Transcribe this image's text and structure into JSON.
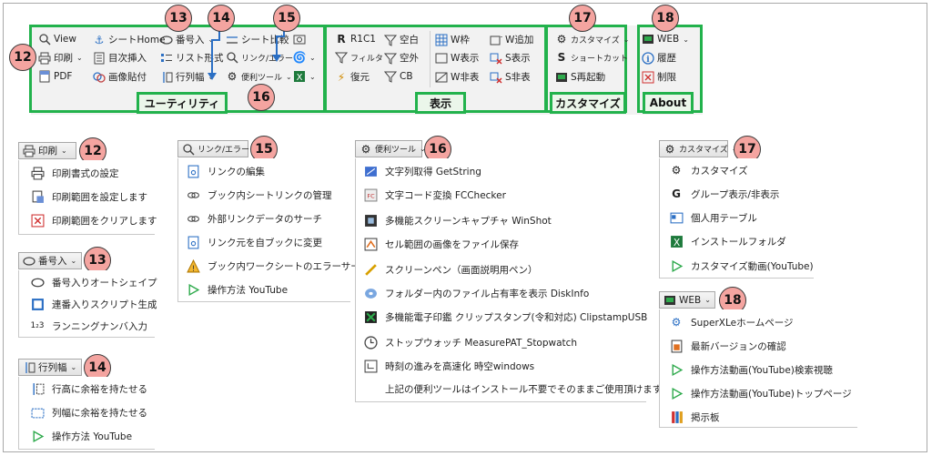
{
  "ribbon": {
    "utility": {
      "group_label": "ユーティリティ",
      "view": "View",
      "print": "印刷",
      "pdf": "PDF",
      "sheet_home": "シートHome",
      "toc_insert": "目次挿入",
      "paste_image": "画像貼付",
      "number_insert": "番号入",
      "list_format": "リスト形式",
      "row_col_width": "行列幅",
      "sheet_compare": "シート比較",
      "link_error": "リンク/エラー",
      "tools": "便利ツール"
    },
    "display": {
      "group_label": "表示",
      "r1c1": "R1C1",
      "blank": "空白",
      "filter": "フィルタ",
      "outside": "空外",
      "restore": "復元",
      "cb": "CB",
      "wframe": "W枠",
      "wshow": "W表示",
      "whide": "W非表",
      "wadd": "W追加",
      "sshow": "S表示",
      "shide": "S非表"
    },
    "customize": {
      "group_label": "カスタマイズ",
      "customize": "カスタマイズ",
      "shortcut": "ショートカット",
      "restart": "S再起動"
    },
    "about": {
      "group_label": "About",
      "web": "WEB",
      "history": "履歴",
      "limits": "制限"
    }
  },
  "badges": {
    "b12": "12",
    "b13": "13",
    "b14": "14",
    "b15": "15",
    "b16": "16",
    "b17": "17",
    "b18": "18"
  },
  "menus": {
    "print": {
      "head": "印刷",
      "items": [
        "印刷書式の設定",
        "印刷範囲を設定します",
        "印刷範囲をクリアします"
      ]
    },
    "number": {
      "head": "番号入",
      "items": [
        "番号入りオートシェイプ",
        "連番入りスクリプト生成",
        "ランニングナンバ入力"
      ]
    },
    "rowcol": {
      "head": "行列幅",
      "items": [
        "行高に余裕を持たせる",
        "列幅に余裕を持たせる",
        "操作方法 YouTube"
      ]
    },
    "link": {
      "head": "リンク/エラー",
      "items": [
        "リンクの編集",
        "ブック内シートリンクの管理",
        "外部リンクデータのサーチ",
        "リンク元を自ブックに変更",
        "ブック内ワークシートのエラーサーチ",
        "操作方法 YouTube"
      ]
    },
    "tools": {
      "head": "便利ツール",
      "items": [
        "文字列取得 GetString",
        "文字コード変換 FCChecker",
        "多機能スクリーンキャプチャ WinShot",
        "セル範囲の画像をファイル保存",
        "スクリーンペン（画面説明用ペン）",
        "フォルダー内のファイル占有率を表示 DiskInfo",
        "多機能電子印鑑 クリップスタンプ(令和対応) ClipstampUSB",
        "ストップウォッチ MeasurePAT_Stopwatch",
        "時刻の進みを高速化 時空windows",
        "上記の便利ツールはインストール不要でそのままご使用頂けます"
      ]
    },
    "customize": {
      "head": "カスタマイズ",
      "items": [
        "カスタマイズ",
        "グループ表示/非表示",
        "個人用テーブル",
        "インストールフォルダ",
        "カスタマイズ動画(YouTube)"
      ]
    },
    "web": {
      "head": "WEB",
      "items": [
        "SuperXLeホームページ",
        "最新バージョンの確認",
        "操作方法動画(YouTube)検索視聴",
        "操作方法動画(YouTube)トップページ",
        "掲示板"
      ]
    }
  },
  "colors": {
    "group_border": "#22b24c",
    "badge_fill": "#f4a4a0",
    "arrow": "#2b6fc4"
  }
}
